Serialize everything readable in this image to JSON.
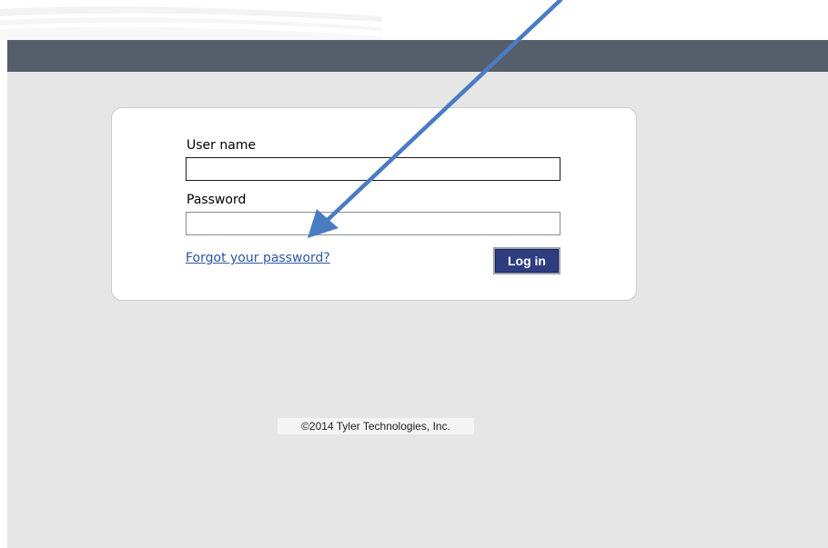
{
  "header": {
    "bar_color": "#575e6b"
  },
  "login_form": {
    "username_label": "User name",
    "username_value": "",
    "password_label": "Password",
    "password_value": "",
    "forgot_password_link": "Forgot your password?",
    "login_button_label": "Log in",
    "accent_color": "#2f3d80",
    "link_color": "#2d57a4"
  },
  "footer": {
    "copyright": "©2014 Tyler Technologies, Inc."
  },
  "annotation": {
    "arrow_icon": "annotation-arrow-icon",
    "arrow_color": "#4a7cc2"
  }
}
